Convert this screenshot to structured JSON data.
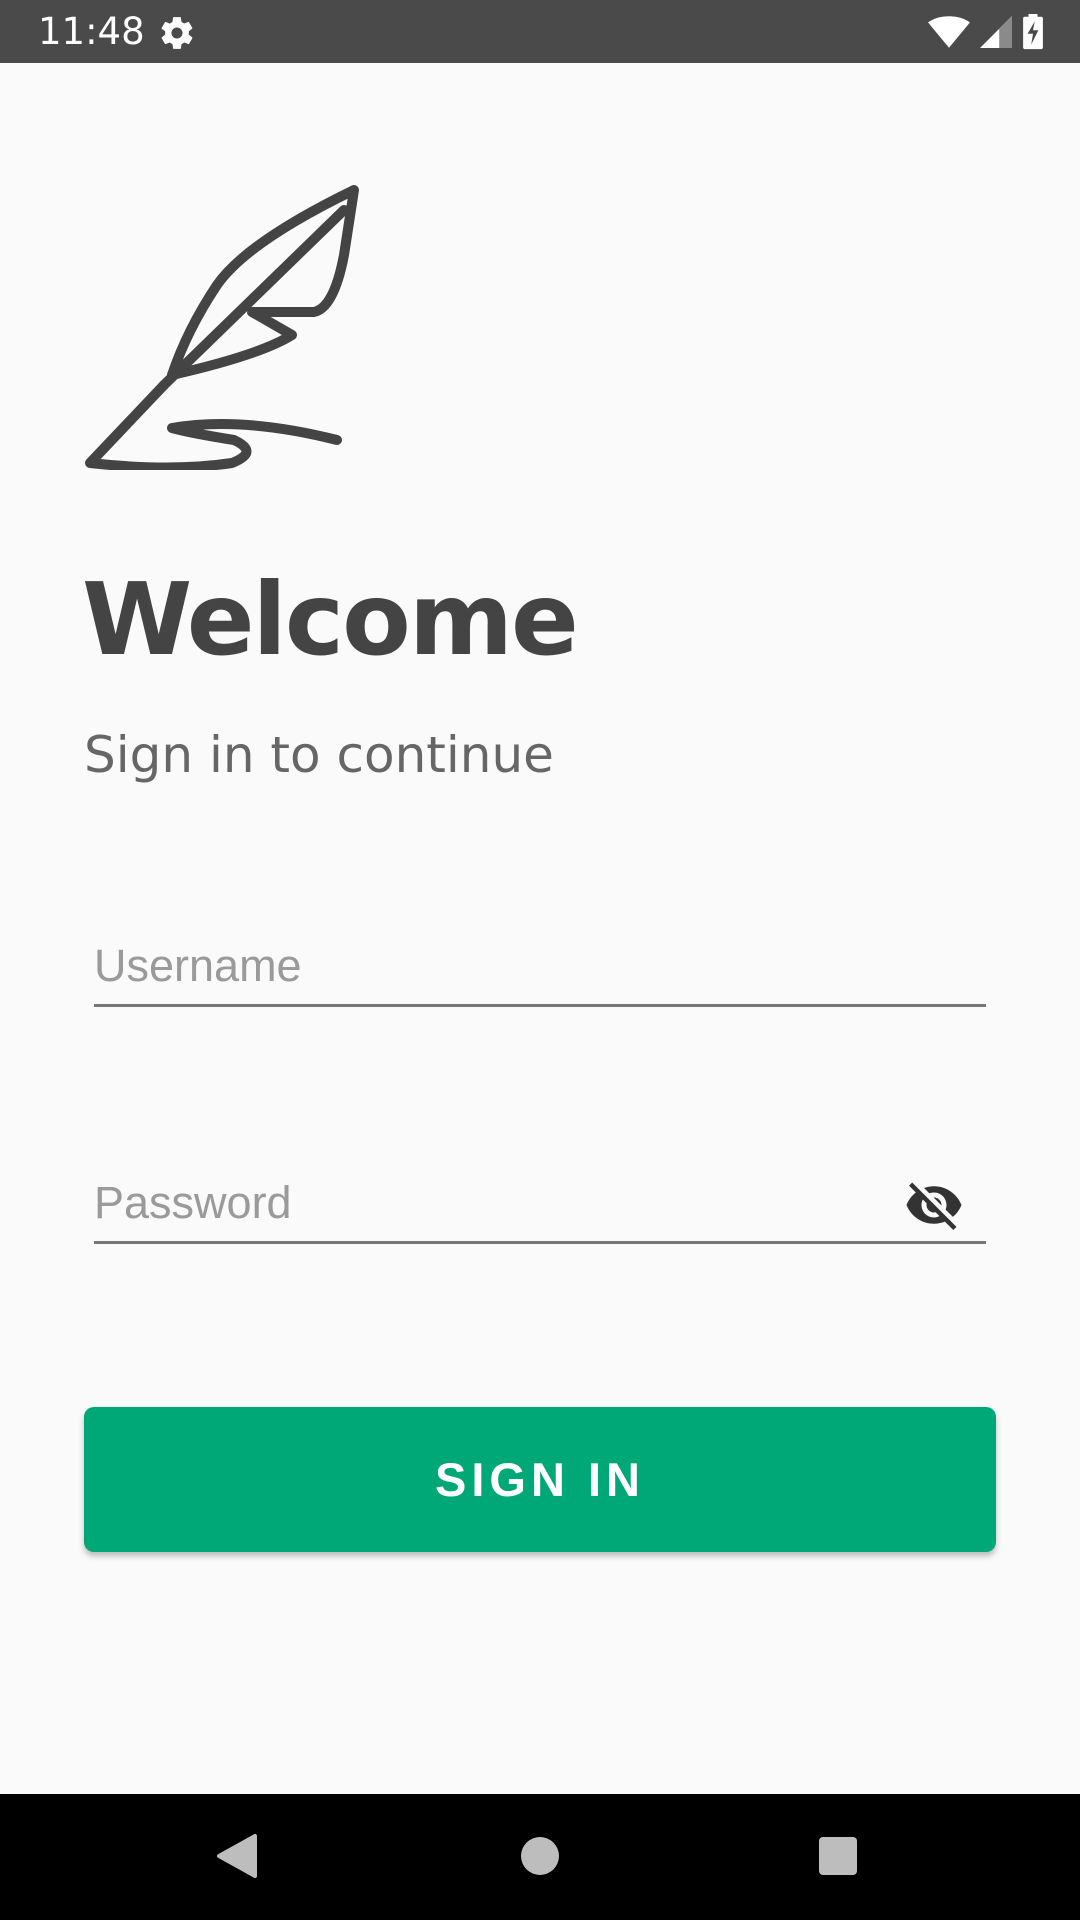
{
  "status_bar": {
    "time": "11:48",
    "left_icons": [
      "gear-icon"
    ],
    "right_icons": [
      "wifi-icon",
      "cell-signal-icon",
      "battery-charging-icon"
    ]
  },
  "login": {
    "logo_icon": "feather-quill-icon",
    "title": "Welcome",
    "subtitle": "Sign in to continue",
    "username": {
      "placeholder": "Username",
      "value": ""
    },
    "password": {
      "placeholder": "Password",
      "value": "",
      "toggle_icon": "visibility-off-icon"
    },
    "sign_in_label": "SIGN IN"
  },
  "nav_bar": {
    "buttons": [
      "back-icon",
      "home-icon",
      "recents-icon"
    ]
  },
  "colors": {
    "primary": "#00a877",
    "status_bar": "#4a4a4a",
    "text_dark": "#444444",
    "text_muted": "#666666",
    "background": "#fafafa"
  }
}
